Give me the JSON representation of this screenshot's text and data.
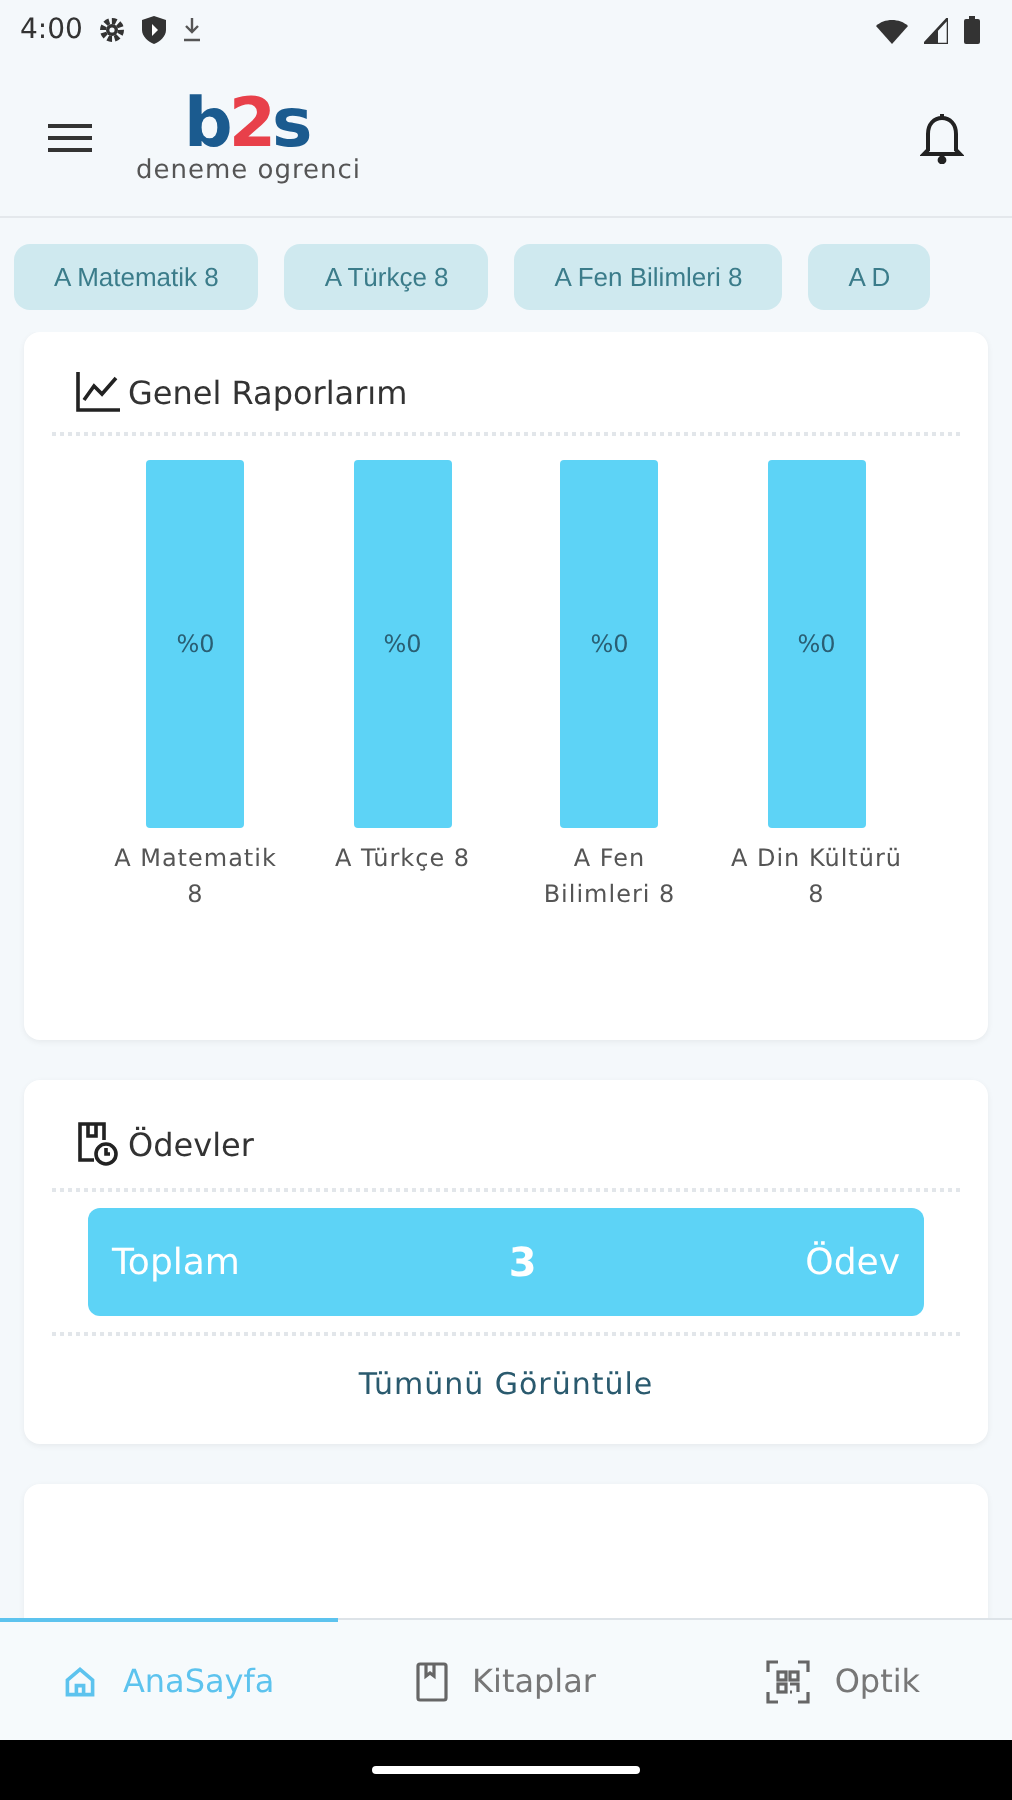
{
  "status_bar": {
    "time": "4:00"
  },
  "app_bar": {
    "logo": "b2s",
    "user": "deneme ogrenci"
  },
  "chips": [
    {
      "label": "A Matematik 8"
    },
    {
      "label": "A Türkçe 8"
    },
    {
      "label": "A Fen Bilimleri 8"
    },
    {
      "label": "A D"
    }
  ],
  "reports_card": {
    "title": "Genel Raporlarım",
    "bars": [
      {
        "label": "A Matematik 8",
        "value": "%0"
      },
      {
        "label": "A Türkçe 8",
        "value": "%0"
      },
      {
        "label": "A Fen Bilimleri 8",
        "value": "%0"
      },
      {
        "label": "A Din Kültürü 8",
        "value": "%0"
      }
    ]
  },
  "homework_card": {
    "title": "Ödevler",
    "total_label": "Toplam",
    "total_count": "3",
    "total_unit": "Ödev",
    "link": "Tümünü Görüntüle"
  },
  "bottom_nav": [
    {
      "label": "AnaSayfa",
      "kind": "home",
      "selected": true
    },
    {
      "label": "Kitaplar",
      "kind": "book",
      "selected": false
    },
    {
      "label": "Optik",
      "kind": "qr",
      "selected": false
    }
  ]
}
